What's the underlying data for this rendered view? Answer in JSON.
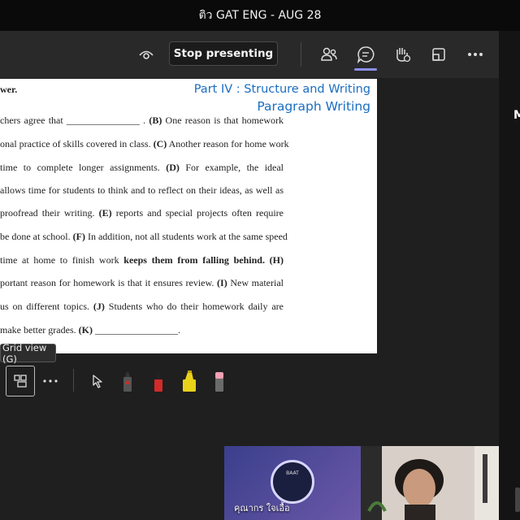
{
  "window": {
    "title": "ติว GAT ENG - AUG 28"
  },
  "toolbar": {
    "stop_presenting_label": "Stop presenting",
    "icons": [
      "eye-icon",
      "people-icon",
      "chat-icon",
      "raise-hand-icon",
      "share-screen-icon",
      "more-options-icon"
    ]
  },
  "right_panel": {
    "letter": "M"
  },
  "slide": {
    "answer_word": "wer.",
    "heading_line1": "Part IV : Structure and Writing",
    "heading_line2": "Paragraph Writing",
    "lines": [
      [
        {
          "t": "chers agree that _______________ .",
          "b": false
        },
        {
          "t": " (B)",
          "b": true
        },
        {
          "t": " One reason is that homework",
          "b": false
        }
      ],
      [
        {
          "t": "onal practice of skills covered in class.",
          "b": false
        },
        {
          "t": " (C)",
          "b": true
        },
        {
          "t": " Another reason for home work",
          "b": false
        }
      ],
      [
        {
          "t": "time to complete longer assignments.",
          "b": false
        },
        {
          "t": " (D)",
          "b": true
        },
        {
          "t": " For example, the ideal",
          "b": false
        }
      ],
      [
        {
          "t": "allows time for students to think and to reflect on their ideas, as well as",
          "b": false
        }
      ],
      [
        {
          "t": "proofread their writing.",
          "b": false
        },
        {
          "t": " (E)",
          "b": true
        },
        {
          "t": " reports and special projects often require",
          "b": false
        }
      ],
      [
        {
          "t": "be done at school.",
          "b": false
        },
        {
          "t": " (F)",
          "b": true
        },
        {
          "t": " In addition, not all students work at the same speed",
          "b": false
        }
      ],
      [
        {
          "t": "time at home to finish work ",
          "b": false
        },
        {
          "t": "keeps them from falling behind. (H)",
          "b": true
        }
      ],
      [
        {
          "t": "portant reason for homework is that it ensures review.",
          "b": false
        },
        {
          "t": " (I)",
          "b": true
        },
        {
          "t": " New material",
          "b": false
        }
      ],
      [
        {
          "t": "us on different topics.",
          "b": false
        },
        {
          "t": " (J)",
          "b": true
        },
        {
          "t": " Students who do their homework daily are",
          "b": false
        }
      ],
      [
        {
          "t": "make better grades.",
          "b": false
        },
        {
          "t": " (K)",
          "b": true
        },
        {
          "t": " _________________.",
          "b": false
        }
      ]
    ]
  },
  "tooltip": {
    "text": "Grid view (G)"
  },
  "annotation_tools": [
    "grid-view-icon",
    "more-icon",
    "pointer-icon",
    "pen-black-icon",
    "pen-red-icon",
    "highlighter-yellow-icon",
    "eraser-icon"
  ],
  "participants": [
    {
      "name": "คุณากร ใจเอื้อ",
      "logo_text": "BAAT"
    },
    {
      "name": ""
    }
  ],
  "colors": {
    "heading": "#1a6dc2",
    "accent": "#8c8ff0",
    "pen_red": "#d22a2a",
    "highlighter": "#e8d21a"
  }
}
